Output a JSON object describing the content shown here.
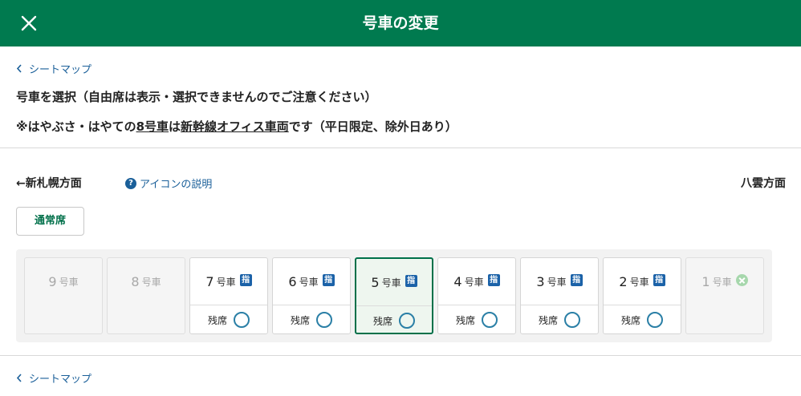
{
  "header": {
    "title": "号車の変更",
    "close_icon": "close-icon"
  },
  "back_link_label": "シートマップ",
  "notice": {
    "line1": "号車を選択（自由席は表示・選択できませんのでご注意ください）",
    "line2_prefix": "※はやぶさ・はやての",
    "line2_car": "8号車",
    "line2_mid": "は",
    "line2_link": "新幹線オフィス車両",
    "line2_suffix": "です（平日限定、除外日あり）"
  },
  "direction": {
    "left": "←新札幌方面",
    "right": "八雲方面"
  },
  "icon_help_label": "アイコンの説明",
  "help_icon_glyph": "?",
  "seat_type_button": "通常席",
  "car_unit": "号車",
  "seat_label": "残席",
  "reserved_glyph": "指",
  "colors": {
    "header": "#007a4f",
    "accent": "#00704a",
    "link": "#1a5f99",
    "reserved_badge": "#1b62a8"
  },
  "cars": [
    {
      "num": "9",
      "status": "disabled",
      "reserved": false,
      "available": false
    },
    {
      "num": "8",
      "status": "disabled",
      "reserved": false,
      "available": false
    },
    {
      "num": "7",
      "status": "normal",
      "reserved": true,
      "available": true
    },
    {
      "num": "6",
      "status": "normal",
      "reserved": true,
      "available": true
    },
    {
      "num": "5",
      "status": "selected",
      "reserved": true,
      "available": true
    },
    {
      "num": "4",
      "status": "normal",
      "reserved": true,
      "available": true
    },
    {
      "num": "3",
      "status": "normal",
      "reserved": true,
      "available": true
    },
    {
      "num": "2",
      "status": "normal",
      "reserved": true,
      "available": true
    },
    {
      "num": "1",
      "status": "disabled",
      "reserved": false,
      "available": false,
      "not_available_icon": true
    }
  ]
}
